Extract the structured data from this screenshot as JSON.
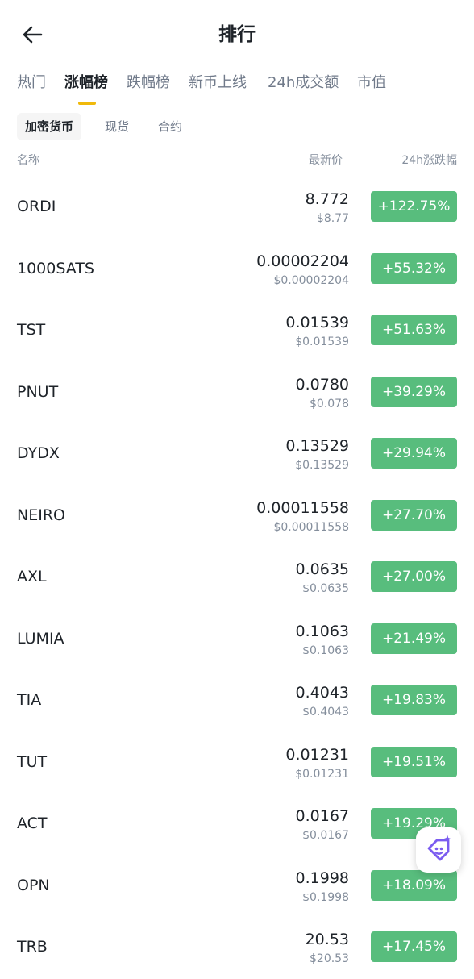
{
  "header": {
    "back_icon": "arrow-left-icon",
    "title": "排行"
  },
  "tabs": [
    {
      "label": "热门",
      "active": false
    },
    {
      "label": "涨幅榜",
      "active": true
    },
    {
      "label": "跌幅榜",
      "active": false
    },
    {
      "label": "新币上线",
      "active": false
    },
    {
      "label": "24h成交额",
      "active": false
    },
    {
      "label": "市值",
      "active": false
    }
  ],
  "subtabs": [
    {
      "label": "加密货币",
      "active": true
    },
    {
      "label": "现货",
      "active": false
    },
    {
      "label": "合约",
      "active": false
    }
  ],
  "columns": {
    "name": "名称",
    "price": "最新价",
    "change": "24h涨跌幅"
  },
  "rows": [
    {
      "symbol": "ORDI",
      "price": "8.772",
      "usd": "$8.77",
      "change": "+122.75%"
    },
    {
      "symbol": "1000SATS",
      "price": "0.00002204",
      "usd": "$0.00002204",
      "change": "+55.32%"
    },
    {
      "symbol": "TST",
      "price": "0.01539",
      "usd": "$0.01539",
      "change": "+51.63%"
    },
    {
      "symbol": "PNUT",
      "price": "0.0780",
      "usd": "$0.078",
      "change": "+39.29%"
    },
    {
      "symbol": "DYDX",
      "price": "0.13529",
      "usd": "$0.13529",
      "change": "+29.94%"
    },
    {
      "symbol": "NEIRO",
      "price": "0.00011558",
      "usd": "$0.00011558",
      "change": "+27.70%"
    },
    {
      "symbol": "AXL",
      "price": "0.0635",
      "usd": "$0.0635",
      "change": "+27.00%"
    },
    {
      "symbol": "LUMIA",
      "price": "0.1063",
      "usd": "$0.1063",
      "change": "+21.49%"
    },
    {
      "symbol": "TIA",
      "price": "0.4043",
      "usd": "$0.4043",
      "change": "+19.83%"
    },
    {
      "symbol": "TUT",
      "price": "0.01231",
      "usd": "$0.01231",
      "change": "+19.51%"
    },
    {
      "symbol": "ACT",
      "price": "0.0167",
      "usd": "$0.0167",
      "change": "+19.29%"
    },
    {
      "symbol": "OPN",
      "price": "0.1998",
      "usd": "$0.1998",
      "change": "+18.09%"
    },
    {
      "symbol": "TRB",
      "price": "20.53",
      "usd": "$20.53",
      "change": "+17.45%"
    }
  ],
  "colors": {
    "positive": "#58bd7d",
    "accent": "#f0b90b",
    "assistant": "#7b5cf0"
  },
  "assistant": {
    "icon": "ai-assistant-icon"
  }
}
